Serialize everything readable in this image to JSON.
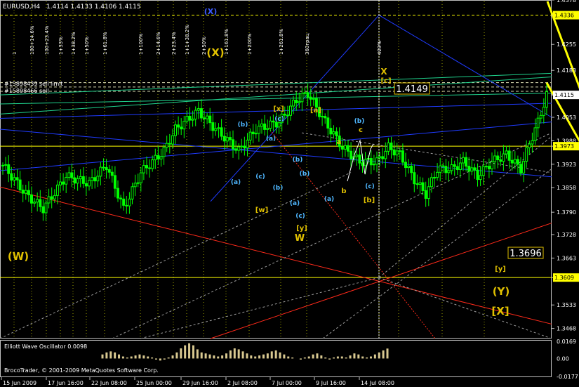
{
  "header": {
    "symbol": "EURUSD,H4",
    "ohlc": "1.4114 1.4133 1.4106 1.4115",
    "orders": [
      "#15898439 sell limit",
      "#15898466 sell"
    ]
  },
  "chart_data": {
    "type": "candlestick",
    "symbol": "EURUSD",
    "timeframe": "H4",
    "last_close": 1.4115,
    "ylim": [
      1.344,
      1.4378
    ],
    "price_axis_ticks": [
      "1.4378",
      "1.4336",
      "1.4255",
      "1.4183",
      "1.4115",
      "1.4053",
      "1.3988",
      "1.3973",
      "1.3923",
      "1.3858",
      "1.3790",
      "1.3728",
      "1.3663",
      "1.3609",
      "1.3533",
      "1.3468"
    ],
    "time_axis_ticks": [
      "15 Jun 2009",
      "17 Jun 16:00",
      "22 Jun 08:00",
      "25 Jun 00:00",
      "29 Jun 16:00",
      "2 Jul 08:00",
      "7 Jul 00:00",
      "9 Jul 16:00",
      "14 Jul 08:00"
    ],
    "price_labels": [
      {
        "text": "1.4336",
        "color": "#ffff00"
      },
      {
        "text": "1.4115",
        "color": "#ffffff"
      },
      {
        "text": "1.3973",
        "color": "#ffff00"
      },
      {
        "text": "1.3609",
        "color": "#ffff00"
      }
    ],
    "bar_count": 190,
    "close_path": [
      [
        0,
        1.392
      ],
      [
        8,
        1.384
      ],
      [
        14,
        1.38
      ],
      [
        22,
        1.389
      ],
      [
        30,
        1.387
      ],
      [
        36,
        1.392
      ],
      [
        42,
        1.38
      ],
      [
        48,
        1.39
      ],
      [
        56,
        1.396
      ],
      [
        60,
        1.402
      ],
      [
        68,
        1.407
      ],
      [
        74,
        1.402
      ],
      [
        82,
        1.396
      ],
      [
        88,
        1.402
      ],
      [
        96,
        1.404
      ],
      [
        102,
        1.41
      ],
      [
        106,
        1.412
      ],
      [
        112,
        1.404
      ],
      [
        118,
        1.397
      ],
      [
        124,
        1.393
      ],
      [
        130,
        1.393
      ],
      [
        134,
        1.397
      ],
      [
        138,
        1.395
      ],
      [
        143,
        1.388
      ],
      [
        147,
        1.384
      ],
      [
        151,
        1.391
      ],
      [
        156,
        1.391
      ],
      [
        160,
        1.393
      ],
      [
        165,
        1.389
      ],
      [
        170,
        1.393
      ],
      [
        175,
        1.395
      ],
      [
        180,
        1.391
      ],
      [
        183,
        1.398
      ],
      [
        186,
        1.404
      ],
      [
        189,
        1.4115
      ]
    ],
    "forecast_path": [
      [
        189,
        1.4149
      ],
      [
        221,
        1.3696
      ],
      [
        255,
        1.4378
      ]
    ],
    "wave_labels": [
      {
        "text": "(W)",
        "color": "#e0c000"
      },
      {
        "text": "(X)",
        "color": "#e0c000"
      },
      {
        "text": "(X)",
        "color": "#3b5bff"
      },
      {
        "text": "W",
        "color": "#e0c000"
      },
      {
        "text": "X",
        "color": "#e0c000"
      },
      {
        "text": "[x]",
        "color": "#e0c000"
      },
      {
        "text": "[a]",
        "color": "#e0c000"
      },
      {
        "text": "[c]",
        "color": "#e0c000"
      },
      {
        "text": "[w]",
        "color": "#e0c000"
      },
      {
        "text": "[y]",
        "color": "#e0c000"
      },
      {
        "text": "[b]",
        "color": "#e0c000"
      },
      {
        "text": "[y]",
        "color": "#e0c000"
      },
      {
        "text": "(Y)",
        "color": "#e0c000"
      },
      {
        "text": "[X]",
        "color": "#e0c000"
      },
      {
        "text": "a",
        "color": "#e0c000"
      },
      {
        "text": "b",
        "color": "#e0c000"
      },
      {
        "text": "c",
        "color": "#e0c000"
      },
      {
        "text": "(a)",
        "color": "#4fb7ff"
      },
      {
        "text": "(b)",
        "color": "#4fb7ff"
      },
      {
        "text": "(c)",
        "color": "#4fb7ff"
      },
      {
        "text": "(a)",
        "color": "#4fb7ff"
      },
      {
        "text": "(b)",
        "color": "#4fb7ff"
      },
      {
        "text": "(c)",
        "color": "#4fb7ff"
      },
      {
        "text": "(a)",
        "color": "#4fb7ff"
      },
      {
        "text": "(b)",
        "color": "#4fb7ff"
      },
      {
        "text": "(c)",
        "color": "#4fb7ff"
      },
      {
        "text": "(b)",
        "color": "#4fb7ff"
      },
      {
        "text": "(a)",
        "color": "#4fb7ff"
      },
      {
        "text": "(b)",
        "color": "#4fb7ff"
      },
      {
        "text": "(c)",
        "color": "#4fb7ff"
      }
    ],
    "boxed_prices": [
      {
        "text": "1.4149",
        "color": "#e0c000"
      },
      {
        "text": "1.3696",
        "color": "#e0c000"
      }
    ],
    "fib_time_labels": [
      "1",
      "100+14.6%",
      "100+23.4%",
      "1+33%",
      "1+38.2%",
      "1+50%",
      "1+61.8%",
      "1+100%",
      "2+14.6%",
      "2+23.4%",
      "1+1+38.2%",
      "2+50%",
      "1+161.8%",
      "1+200%",
      "1+261.8%",
      "360грац",
      "423%"
    ],
    "oscillator": {
      "title": "Elliott Wave Oscillator 0.0098",
      "ylim": [
        -0.0177,
        0.0169
      ],
      "ticks": [
        "0.0169",
        "0.00",
        "-0.0177"
      ],
      "values": [
        0.004,
        0.006,
        0.007,
        0.006,
        0.004,
        0.002,
        0.001,
        0.002,
        0.003,
        0.004,
        0.003,
        0.002,
        0.001,
        -0.001,
        -0.002,
        -0.001,
        0.001,
        0.003,
        0.006,
        0.01,
        0.013,
        0.015,
        0.013,
        0.009,
        0.006,
        0.005,
        0.004,
        0.003,
        0.002,
        0.003,
        0.005,
        0.008,
        0.01,
        0.009,
        0.007,
        0.005,
        0.003,
        0.002,
        0.003,
        0.004,
        0.005,
        0.007,
        0.008,
        0.006,
        0.004,
        0.002,
        0.001,
        0.0,
        -0.001,
        0.001,
        0.002,
        0.004,
        0.005,
        0.003,
        0.001,
        -0.001,
        0.001,
        0.002,
        0.002,
        0.001,
        0.003,
        0.005,
        0.004,
        0.002,
        0.001,
        0.002,
        0.004,
        0.006,
        0.008,
        0.0098
      ]
    }
  },
  "footer": {
    "copyright": "BrocoTrader, © 2001-2009 MetaQuotes Software Corp."
  }
}
